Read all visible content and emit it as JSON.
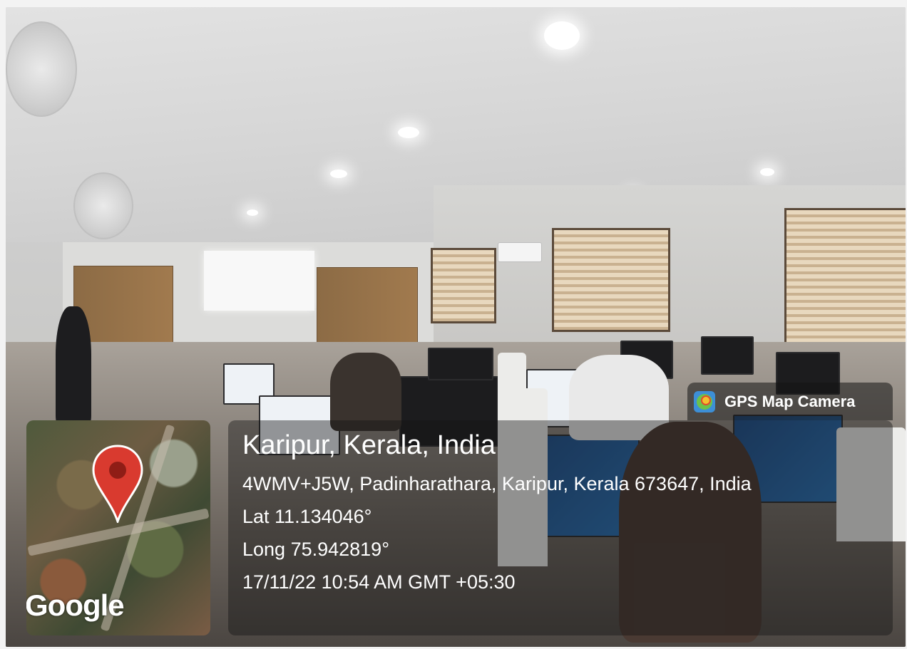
{
  "badge": {
    "icon": "gps-map-camera-icon",
    "label": "GPS Map Camera"
  },
  "location": {
    "title": "Karipur, Kerala, India",
    "address": "4WMV+J5W, Padinharathara, Karipur, Kerala 673647, India",
    "lat": "Lat 11.134046°",
    "long": "Long 75.942819°",
    "datetime": "17/11/22 10:54 AM GMT +05:30"
  },
  "map": {
    "attribution": "Google",
    "marker_icon": "map-pin-icon",
    "marker_color": "#d93a2f"
  }
}
